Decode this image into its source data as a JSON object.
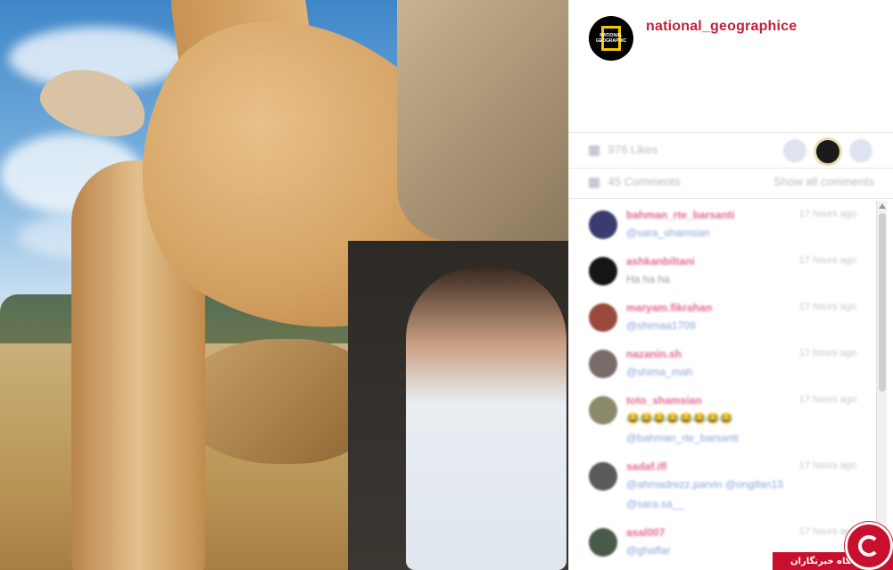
{
  "post": {
    "username": "national_geographice",
    "avatar_logo_text": "NATIONAL GEOGRAPHIC",
    "photo_description_icon": "photo-giraffe-selfie",
    "likes_label": "976 Likes",
    "comments_label": "45 Comments",
    "show_all_label": "Show all comments"
  },
  "comments": [
    {
      "user": "bahman_rte_barsanti",
      "text": "@sara_shamsian",
      "time": "17 hours ago",
      "avatar_color": "#3b3b6e"
    },
    {
      "user": "ashkanbiltani",
      "text": "Ha ha ha",
      "time": "17 hours ago",
      "avatar_color": "#151515"
    },
    {
      "user": "maryam.fikrahan",
      "text": "@shimaa1709",
      "time": "17 hours ago",
      "avatar_color": "#9a4a3c"
    },
    {
      "user": "nazanin.sh",
      "text": "@shima_mah",
      "time": "17 hours ago",
      "avatar_color": "#7a6a6a"
    },
    {
      "user": "toto_shamsian",
      "text": "😂😂😂😂😂😂😂😂",
      "text2": "@bahman_rte_barsanti",
      "time": "17 hours ago",
      "avatar_color": "#8a8a6a"
    },
    {
      "user": "sadaf.ifl",
      "text": "@ahmadrezz.parvin @ongifan13",
      "text2": "@sara.sa__",
      "time": "17 hours ago",
      "avatar_color": "#5a5a5a"
    },
    {
      "user": "asal007",
      "text": "@ghaffar",
      "time": "17 hours ago",
      "avatar_color": "#4a5a4a"
    }
  ],
  "watermark": {
    "text": "باشگاه خبرنگاران",
    "brand_color": "#c8102e"
  },
  "colors": {
    "username": "#c0213a",
    "comment_user": "#e26a8a",
    "comment_text": "#8aa6d8"
  }
}
